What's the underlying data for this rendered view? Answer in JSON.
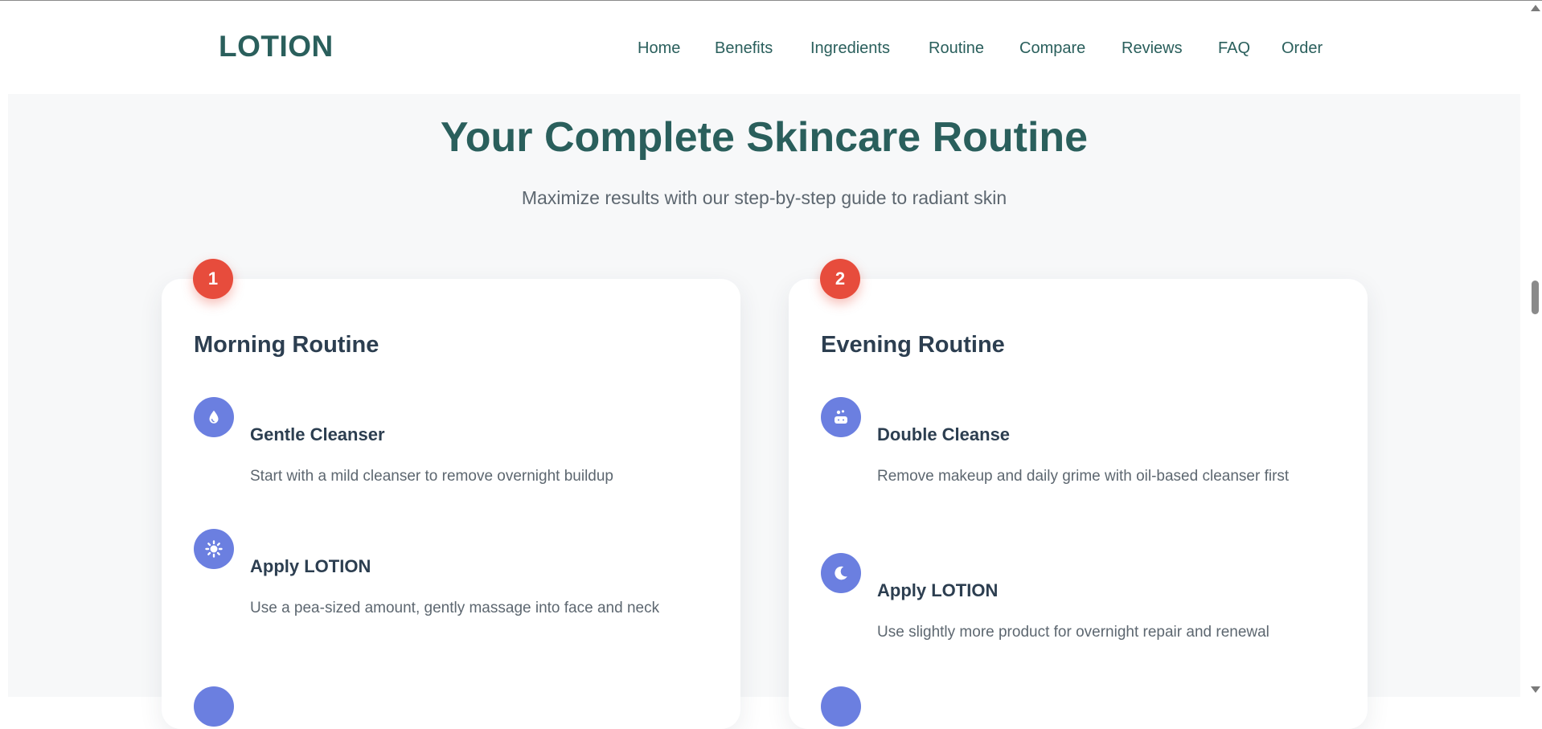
{
  "brand": {
    "logo": "LOTION"
  },
  "nav": {
    "items": [
      {
        "label": "Home"
      },
      {
        "label": "Benefits"
      },
      {
        "label": "Ingredients"
      },
      {
        "label": "Routine"
      },
      {
        "label": "Compare"
      },
      {
        "label": "Reviews"
      },
      {
        "label": "FAQ"
      },
      {
        "label": "Order"
      }
    ]
  },
  "section": {
    "title": "Your Complete Skincare Routine",
    "subtitle": "Maximize results with our step-by-step guide to radiant skin"
  },
  "routines": [
    {
      "number": "1",
      "title": "Morning Routine",
      "steps": [
        {
          "icon": "droplet-icon",
          "title": "Gentle Cleanser",
          "description": "Start with a mild cleanser to remove overnight buildup"
        },
        {
          "icon": "sun-icon",
          "title": "Apply LOTION",
          "description": "Use a pea-sized amount, gently massage into face and neck"
        }
      ]
    },
    {
      "number": "2",
      "title": "Evening Routine",
      "steps": [
        {
          "icon": "soap-icon",
          "title": "Double Cleanse",
          "description": "Remove makeup and daily grime with oil-based cleanser first"
        },
        {
          "icon": "moon-icon",
          "title": "Apply LOTION",
          "description": "Use slightly more product for overnight repair and renewal"
        }
      ]
    }
  ],
  "colors": {
    "brand": "#2a5f5c",
    "badge": "#e74c3c",
    "icon_bg": "#6b7fe0",
    "heading": "#2c3e50",
    "body_text": "#5d6770",
    "section_bg": "#f7f8f9"
  }
}
